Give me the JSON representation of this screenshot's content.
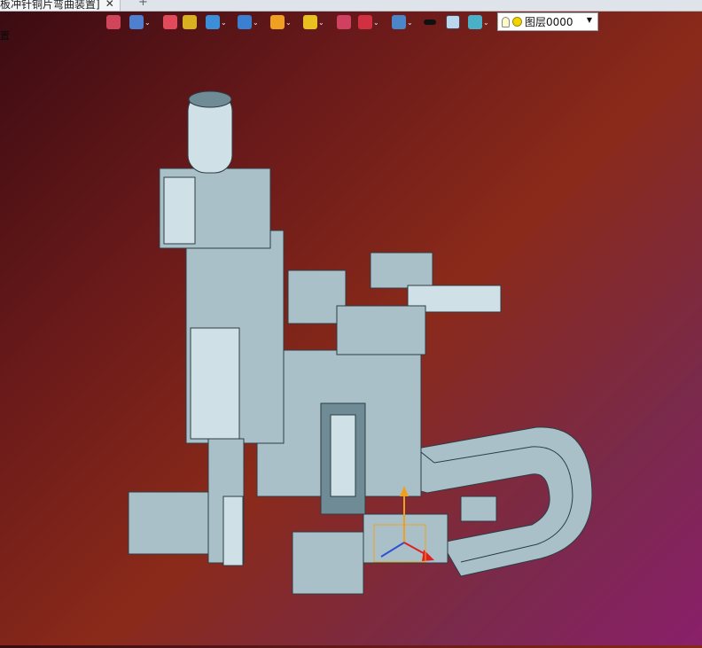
{
  "tab": {
    "title": "板冲针铜片弯曲装置]",
    "close": "✕",
    "new_tab": "+"
  },
  "sidebar": {
    "fragment": "置"
  },
  "toolbar": {
    "tools": [
      {
        "name": "exit-sketch-icon",
        "color": "#d0455a",
        "dropdown": false
      },
      {
        "name": "view-orient-icon",
        "color": "#4f7fcf",
        "dropdown": true
      },
      {
        "name": "pencil-icon",
        "color": "#e04a5a",
        "dropdown": false
      },
      {
        "name": "box-shaded-icon",
        "color": "#d8b020",
        "dropdown": false
      },
      {
        "name": "cube-icon",
        "color": "#3a8fd8",
        "dropdown": true
      },
      {
        "name": "section-view-icon",
        "color": "#3a7fd0",
        "dropdown": true
      },
      {
        "name": "appearance-icon",
        "color": "#f0a020",
        "dropdown": true
      },
      {
        "name": "zoom-icon",
        "color": "#e8c020",
        "dropdown": true
      },
      {
        "name": "rotate-icon",
        "color": "#d04060",
        "dropdown": false
      },
      {
        "name": "dimension-icon",
        "color": "#d03040",
        "dropdown": true
      },
      {
        "name": "display-settings-icon",
        "color": "#4a86c8",
        "dropdown": true
      },
      {
        "name": "black-square-icon",
        "color": "#111111",
        "dropdown": false
      },
      {
        "name": "light-square-icon",
        "color": "#bcd6ee",
        "dropdown": false
      },
      {
        "name": "plane-icon",
        "color": "#4ab0c8",
        "dropdown": true
      }
    ],
    "layer": {
      "label": "图层0000",
      "dropdown": "▼"
    }
  },
  "colors": {
    "part": "#a9c0c8",
    "part_dark": "#6f8b96",
    "part_light": "#cfe0e6",
    "edge": "#2e3c44",
    "axis_x": "#e02020",
    "axis_y": "#f0a020",
    "axis_z": "#3050d0"
  }
}
